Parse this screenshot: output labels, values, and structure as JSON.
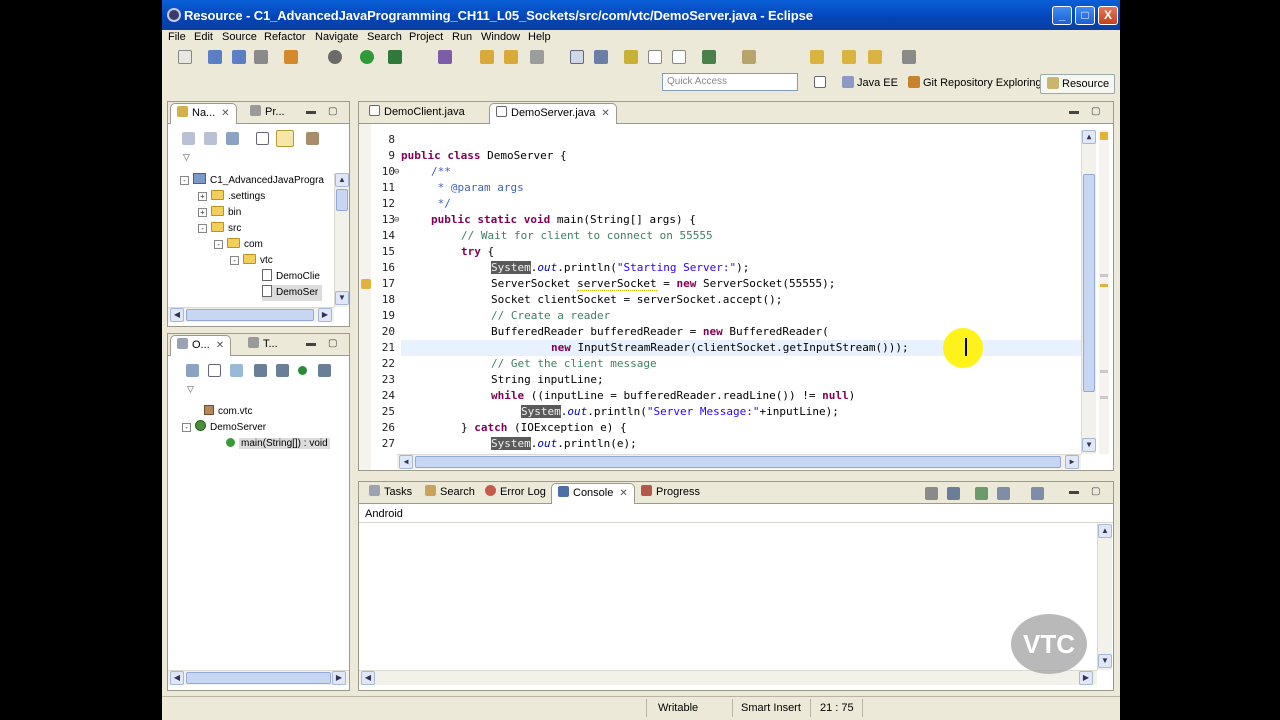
{
  "window": {
    "title": "Resource - C1_AdvancedJavaProgramming_CH11_L05_Sockets/src/com/vtc/DemoServer.java - Eclipse",
    "buttons": {
      "minimize": "_",
      "maximize": "□",
      "close": "X"
    }
  },
  "menu": [
    "File",
    "Edit",
    "Source",
    "Refactor",
    "Navigate",
    "Search",
    "Project",
    "Run",
    "Window",
    "Help"
  ],
  "quick_access": {
    "placeholder": "Quick Access"
  },
  "perspectives": [
    {
      "label": "Java EE",
      "active": false
    },
    {
      "label": "Git Repository Exploring",
      "active": false
    },
    {
      "label": "Resource",
      "active": true
    }
  ],
  "navigator": {
    "tabs": [
      "Na...",
      "Pr..."
    ],
    "tree": [
      {
        "label": "C1_AdvancedJavaProgra",
        "level": 0,
        "toggle": "-",
        "icon": "project"
      },
      {
        "label": ".settings",
        "level": 1,
        "toggle": "+",
        "icon": "folder"
      },
      {
        "label": "bin",
        "level": 1,
        "toggle": "+",
        "icon": "folder"
      },
      {
        "label": "src",
        "level": 1,
        "toggle": "-",
        "icon": "folder"
      },
      {
        "label": "com",
        "level": 2,
        "toggle": "-",
        "icon": "folder"
      },
      {
        "label": "vtc",
        "level": 3,
        "toggle": "-",
        "icon": "folder"
      },
      {
        "label": "DemoClie",
        "level": 4,
        "toggle": "",
        "icon": "file"
      },
      {
        "label": "DemoSer",
        "level": 4,
        "toggle": "",
        "icon": "file",
        "selected": true
      }
    ]
  },
  "outline": {
    "tabs": [
      "O...",
      "T..."
    ],
    "items": [
      {
        "label": "com.vtc",
        "icon": "package"
      },
      {
        "label": "DemoServer",
        "icon": "class"
      },
      {
        "label": "main(String[]) : void",
        "icon": "method"
      }
    ]
  },
  "editor": {
    "tabs": [
      {
        "label": "DemoClient.java",
        "active": false
      },
      {
        "label": "DemoServer.java",
        "active": true
      }
    ],
    "current_line": 21,
    "lines": [
      {
        "n": "8",
        "fold": ""
      },
      {
        "n": "9",
        "fold": ""
      },
      {
        "n": "10",
        "fold": "⊖"
      },
      {
        "n": "11",
        "fold": ""
      },
      {
        "n": "12",
        "fold": ""
      },
      {
        "n": "13",
        "fold": "⊖"
      },
      {
        "n": "14",
        "fold": ""
      },
      {
        "n": "15",
        "fold": ""
      },
      {
        "n": "16",
        "fold": ""
      },
      {
        "n": "17",
        "fold": ""
      },
      {
        "n": "18",
        "fold": ""
      },
      {
        "n": "19",
        "fold": ""
      },
      {
        "n": "20",
        "fold": ""
      },
      {
        "n": "21",
        "fold": ""
      },
      {
        "n": "22",
        "fold": ""
      },
      {
        "n": "23",
        "fold": ""
      },
      {
        "n": "24",
        "fold": ""
      },
      {
        "n": "25",
        "fold": ""
      },
      {
        "n": "26",
        "fold": ""
      },
      {
        "n": "27",
        "fold": ""
      }
    ],
    "code": {
      "l9_kw": "public class",
      "l9_rest": " DemoServer {",
      "l10": "/**",
      "l11": " * @param args",
      "l12": " */",
      "l13_kw": "public static void",
      "l13_rest": " main(String[] args) {",
      "l14": "// Wait for client to connect on 55555",
      "l15_kw": "try",
      "l15_rest": " {",
      "sys": "System",
      "out": "out",
      "l16_a": ".",
      "l16_b": ".println(",
      "l16_str": "\"Starting Server:\"",
      "l16_end": ");",
      "l17_a": "ServerSocket ",
      "l17_var": "serverSocket",
      "l17_b": " = ",
      "kw_new": "new",
      "l17_c": " ServerSocket(55555);",
      "l18": "Socket clientSocket = serverSocket.accept();",
      "l19": "// Create a reader",
      "l20_a": "BufferedReader bufferedReader = ",
      "l20_b": " BufferedReader(",
      "l21_b": " InputStreamReader(clientSocket.getInputStream()));",
      "l22": "// Get the client message",
      "l23": "String inputLine;",
      "l24_kw": "while",
      "l24_a": " ((inputLine = bufferedReader.readLine()) != ",
      "l24_null": "null",
      "l24_b": ")",
      "l25_str": "\"Server Message:\"",
      "l25_end": "+inputLine);",
      "l26_a": "} ",
      "l26_kw": "catch",
      "l26_b": " (IOException e) {",
      "l27_end": ".println(e);"
    }
  },
  "console": {
    "tabs": [
      "Tasks",
      "Search",
      "Error Log",
      "Console",
      "Progress"
    ],
    "active_tab": "Console",
    "label": "Android"
  },
  "statusbar": {
    "mode": "Writable",
    "insert": "Smart Insert",
    "position": "21 : 75"
  },
  "watermark": "VTC"
}
